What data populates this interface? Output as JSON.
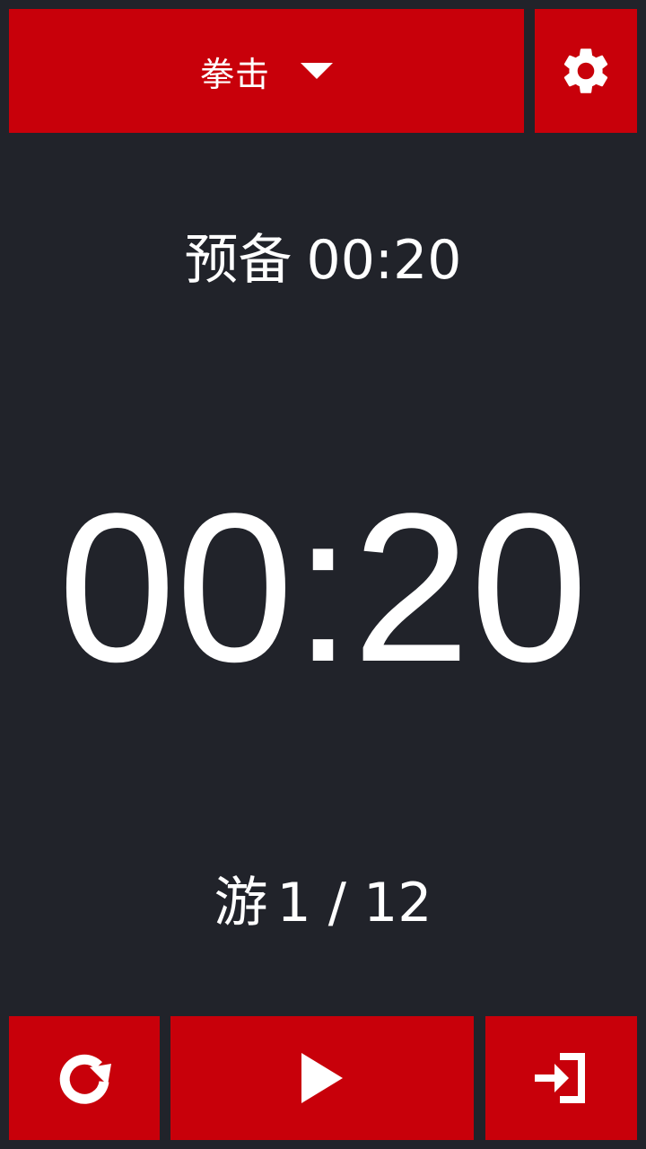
{
  "header": {
    "mode_label": "拳击",
    "dropdown_icon": "triangle-down-icon",
    "settings_icon": "gear-icon"
  },
  "phase": {
    "label": "预备",
    "time": "00:20"
  },
  "timer": {
    "display": "00:20"
  },
  "round": {
    "label": "游",
    "progress": "1 / 12"
  },
  "controls": {
    "reset_icon": "refresh-icon",
    "play_icon": "play-icon",
    "exit_icon": "exit-icon"
  },
  "colors": {
    "background": "#21232a",
    "accent": "#c8000a",
    "text": "#ffffff"
  }
}
